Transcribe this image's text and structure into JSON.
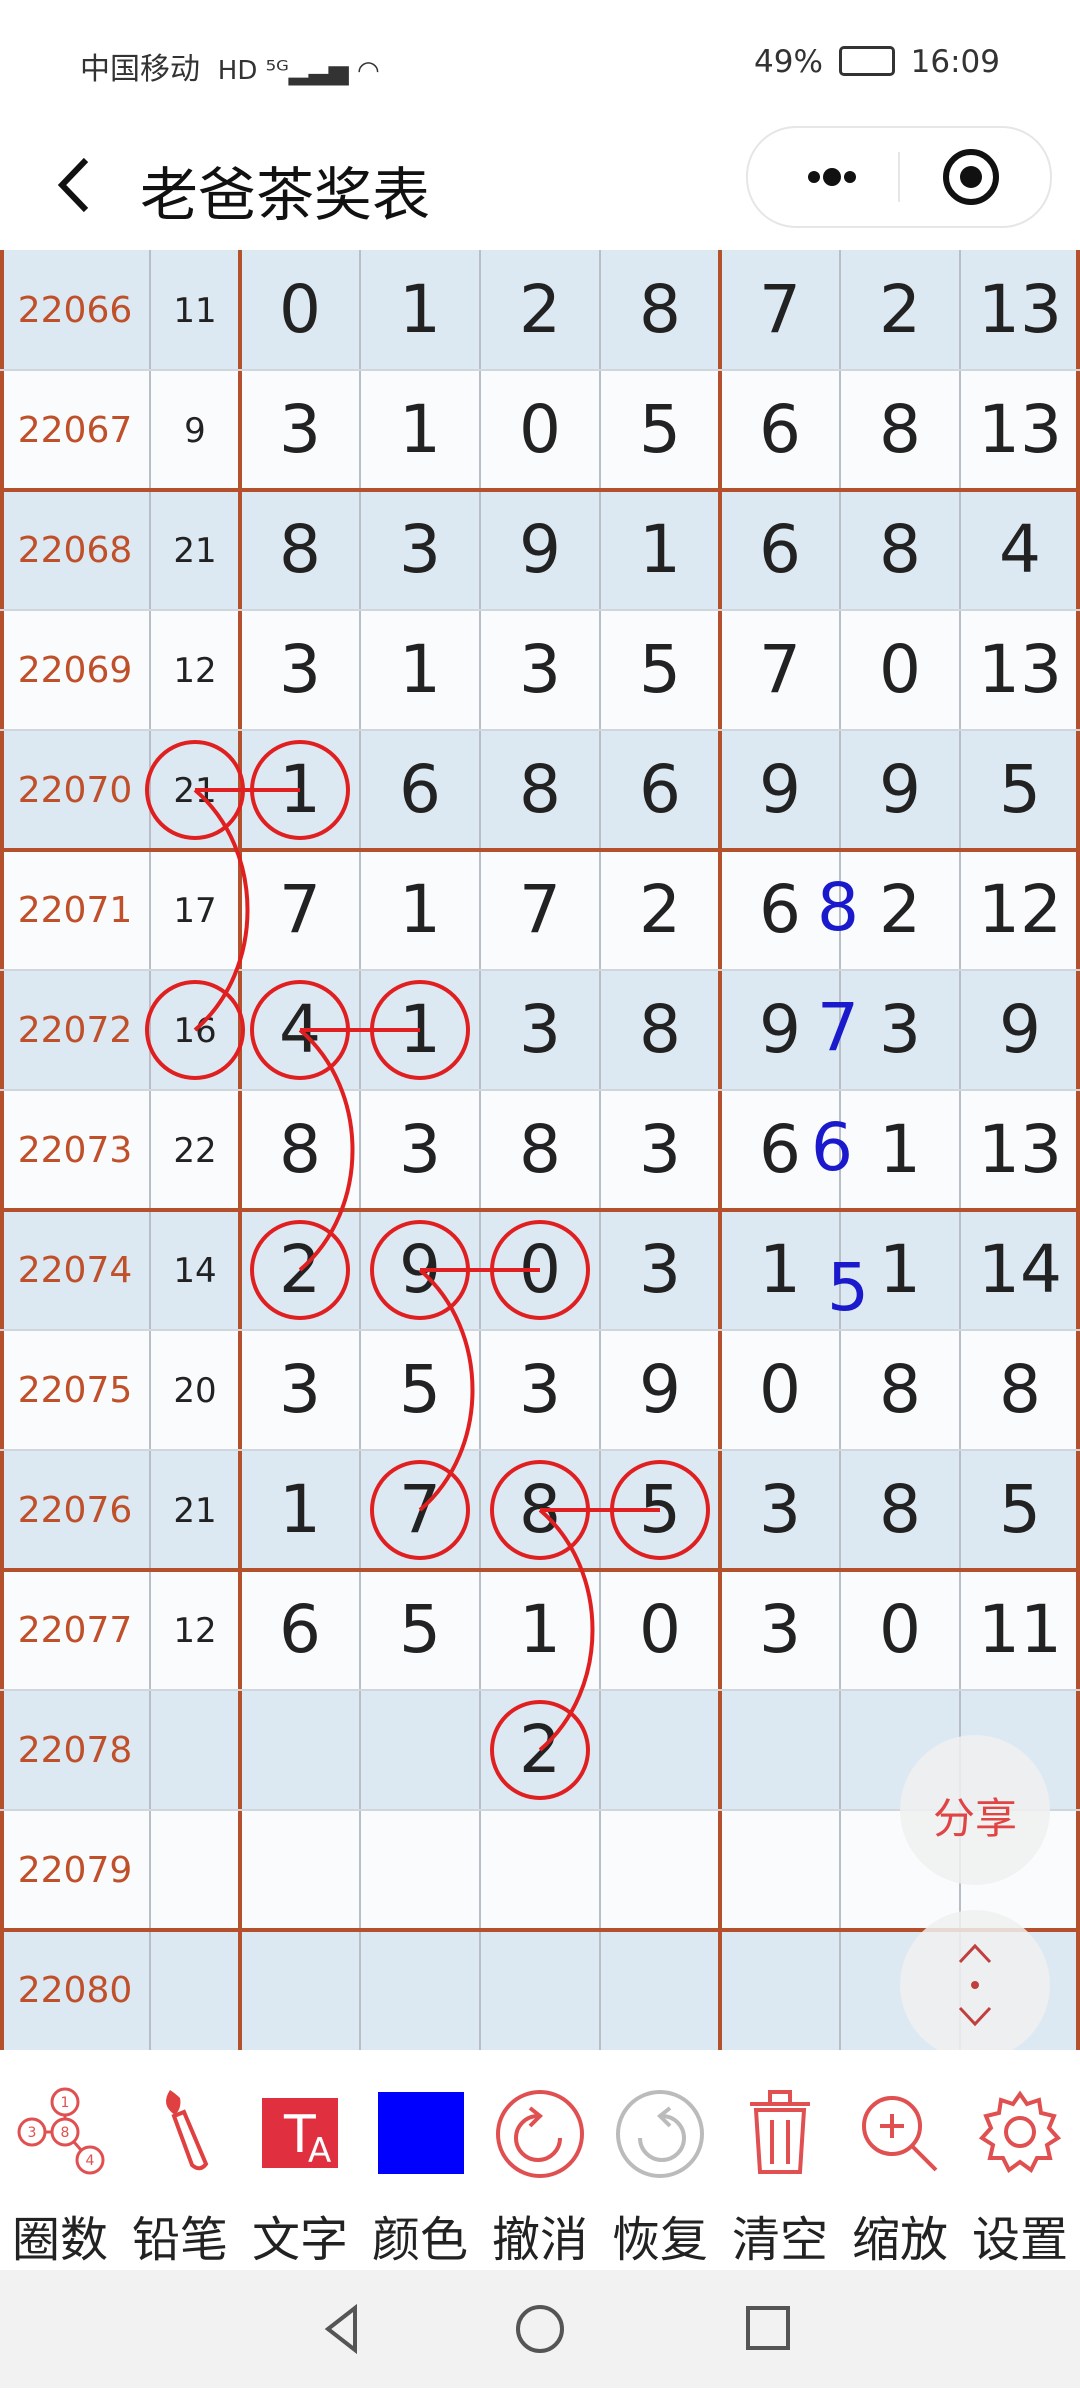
{
  "status_bar": {
    "carrier": "中国移动",
    "battery": "49%",
    "time": "16:09"
  },
  "nav": {
    "title": "老爸茶奖表"
  },
  "table": {
    "rows": [
      {
        "id": "22066",
        "sum": "11",
        "cells": [
          "0",
          "1",
          "2",
          "8",
          "7",
          "2",
          "13"
        ]
      },
      {
        "id": "22067",
        "sum": "9",
        "cells": [
          "3",
          "1",
          "0",
          "5",
          "6",
          "8",
          "13"
        ]
      },
      {
        "id": "22068",
        "sum": "21",
        "cells": [
          "8",
          "3",
          "9",
          "1",
          "6",
          "8",
          "4"
        ]
      },
      {
        "id": "22069",
        "sum": "12",
        "cells": [
          "3",
          "1",
          "3",
          "5",
          "7",
          "0",
          "13"
        ]
      },
      {
        "id": "22070",
        "sum": "21",
        "cells": [
          "1",
          "6",
          "8",
          "6",
          "9",
          "9",
          "5"
        ]
      },
      {
        "id": "22071",
        "sum": "17",
        "cells": [
          "7",
          "1",
          "7",
          "2",
          "6",
          "2",
          "12"
        ]
      },
      {
        "id": "22072",
        "sum": "16",
        "cells": [
          "4",
          "1",
          "3",
          "8",
          "9",
          "3",
          "9"
        ]
      },
      {
        "id": "22073",
        "sum": "22",
        "cells": [
          "8",
          "3",
          "8",
          "3",
          "6",
          "1",
          "13"
        ]
      },
      {
        "id": "22074",
        "sum": "14",
        "cells": [
          "2",
          "9",
          "0",
          "3",
          "1",
          "1",
          "14"
        ]
      },
      {
        "id": "22075",
        "sum": "20",
        "cells": [
          "3",
          "5",
          "3",
          "9",
          "0",
          "8",
          "8"
        ]
      },
      {
        "id": "22076",
        "sum": "21",
        "cells": [
          "1",
          "7",
          "8",
          "5",
          "3",
          "8",
          "5"
        ]
      },
      {
        "id": "22077",
        "sum": "12",
        "cells": [
          "6",
          "5",
          "1",
          "0",
          "3",
          "0",
          "11"
        ]
      },
      {
        "id": "22078",
        "sum": "",
        "cells": [
          "",
          "",
          "2",
          "",
          "",
          "",
          ""
        ]
      },
      {
        "id": "22079",
        "sum": "",
        "cells": [
          "",
          "",
          "",
          "",
          "",
          "",
          ""
        ]
      },
      {
        "id": "22080",
        "sum": "",
        "cells": [
          "",
          "",
          "",
          "",
          "",
          "",
          ""
        ]
      }
    ],
    "blue_annotations": [
      "8",
      "7",
      "6",
      "5"
    ]
  },
  "floating": {
    "share_label": "分享"
  },
  "toolbar": [
    {
      "label": "圈数",
      "icon": "circle-numbers-icon"
    },
    {
      "label": "铅笔",
      "icon": "brush-icon"
    },
    {
      "label": "文字",
      "icon": "text-icon"
    },
    {
      "label": "颜色",
      "icon": "color-swatch-icon"
    },
    {
      "label": "撤消",
      "icon": "undo-icon"
    },
    {
      "label": "恢复",
      "icon": "redo-icon"
    },
    {
      "label": "清空",
      "icon": "trash-icon"
    },
    {
      "label": "缩放",
      "icon": "zoom-in-icon"
    },
    {
      "label": "设置",
      "icon": "gear-icon"
    }
  ],
  "colors": {
    "accent_red": "#e02020",
    "row_blue": "#dce9f3",
    "row_white": "#f9fbfd",
    "border_brown": "#b5502c",
    "blue_pen": "#1a1acc"
  }
}
